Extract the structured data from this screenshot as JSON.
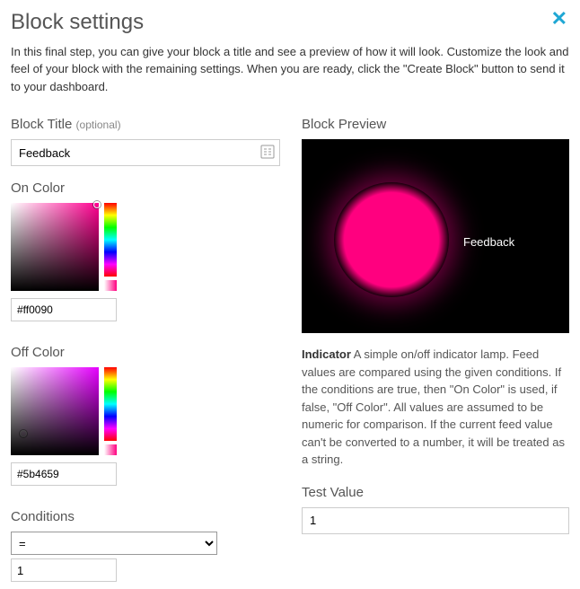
{
  "header": {
    "title": "Block settings",
    "intro": "In this final step, you can give your block a title and see a preview of how it will look. Customize the look and feel of your block with the remaining settings. When you are ready, click the \"Create Block\" button to send it to your dashboard."
  },
  "blockTitle": {
    "label": "Block Title",
    "optional": "(optional)",
    "value": "Feedback"
  },
  "onColor": {
    "label": "On Color",
    "hex": "#ff0090"
  },
  "offColor": {
    "label": "Off Color",
    "hex": "#5b4659"
  },
  "conditions": {
    "label": "Conditions",
    "operator": "=",
    "value": "1"
  },
  "preview": {
    "label": "Block Preview",
    "orbLabel": "Feedback"
  },
  "description": {
    "title": "Indicator",
    "body": " A simple on/off indicator lamp. Feed values are compared using the given conditions. If the conditions are true, then \"On Color\" is used, if false, \"Off Color\". All values are assumed to be numeric for comparison. If the current feed value can't be converted to a number, it will be treated as a string."
  },
  "testValue": {
    "label": "Test Value",
    "value": "1"
  }
}
